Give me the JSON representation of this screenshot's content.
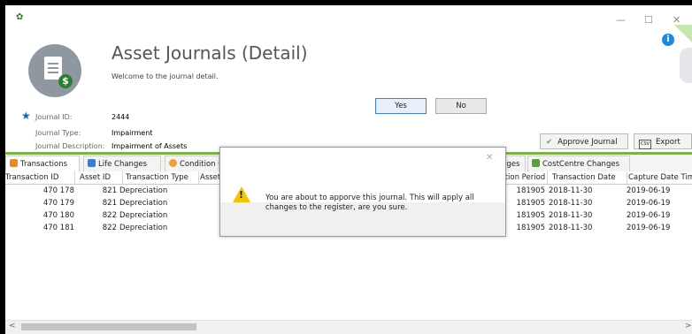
{
  "window": {
    "minimize": "—",
    "maximize": "☐",
    "close": "✕"
  },
  "header": {
    "title": "Asset Journals (Detail)",
    "subtitle": "Welcome to the journal detail."
  },
  "journal": {
    "id_label": "Journal ID:",
    "id_value": "2444",
    "type_label": "Journal Type:",
    "type_value": "Impairment",
    "desc_label": "Journal Description:",
    "desc_value": "Impairment of Assets"
  },
  "toolbar": {
    "approve_label": "Approve Journal",
    "export_label": "Export"
  },
  "tabs": [
    {
      "label": "Transactions",
      "icon": "transactions-icon",
      "color": "#e08e2b"
    },
    {
      "label": "Life Changes",
      "icon": "life-changes-icon",
      "color": "#3a7bd5"
    },
    {
      "label": "Condition C",
      "icon": "condition-icon",
      "color": "#f0a030"
    },
    {
      "label": "nges",
      "icon": "",
      "color": ""
    },
    {
      "label": "CostCentre Changes",
      "icon": "costcentre-icon",
      "color": "#5a9e3a"
    }
  ],
  "grid": {
    "headers": [
      "Transaction ID",
      "Asset ID",
      "Transaction Type",
      "Asset",
      "ction Period",
      "Transaction Date",
      "Capture Date Time"
    ],
    "rows": [
      {
        "tid": "470 178",
        "aid": "821",
        "type": "Depreciation",
        "period": "181905",
        "date": "2018-11-30",
        "capture": "2019-06-19"
      },
      {
        "tid": "470 179",
        "aid": "821",
        "type": "Depreciation",
        "period": "181905",
        "date": "2018-11-30",
        "capture": "2019-06-19"
      },
      {
        "tid": "470 180",
        "aid": "822",
        "type": "Depreciation",
        "period": "181905",
        "date": "2018-11-30",
        "capture": "2019-06-19"
      },
      {
        "tid": "470 181",
        "aid": "822",
        "type": "Depreciation",
        "period": "181905",
        "date": "2018-11-30",
        "capture": "2019-06-19"
      }
    ]
  },
  "scroll": {
    "left_arrow": "<",
    "right_arrow": ">"
  },
  "dialog": {
    "message": "You are about to apporve this journal. This will apply all changes to the register, are you sure.",
    "yes_label": "Yes",
    "no_label": "No",
    "close": "✕"
  },
  "colors": {
    "accent_green": "#7cb342",
    "info_blue": "#1e88e5",
    "warning_yellow": "#f5c400"
  }
}
